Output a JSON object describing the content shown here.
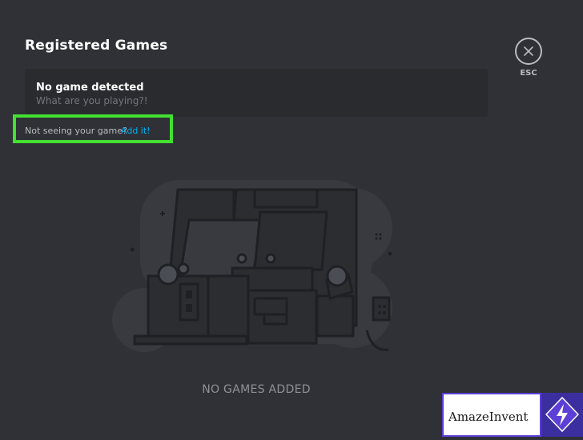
{
  "header": {
    "title": "Registered Games"
  },
  "detection": {
    "title": "No game detected",
    "subtitle": "What are you playing?!"
  },
  "add_game": {
    "prompt": "Not seeing your game?",
    "link": "Add it!"
  },
  "close": {
    "icon": "close-icon",
    "label": "ESC"
  },
  "empty_state": {
    "label": "NO GAMES ADDED",
    "illustration": "arcade-machines-illustration"
  },
  "watermark": {
    "brand_part1": "Amaze",
    "brand_part2": "Invent",
    "icon": "lightning-bolt-icon"
  },
  "colors": {
    "background": "#2f3136",
    "panel": "#292b2f",
    "link": "#00b0f4",
    "highlight": "#43e030",
    "brand": "#5b3fd6"
  }
}
